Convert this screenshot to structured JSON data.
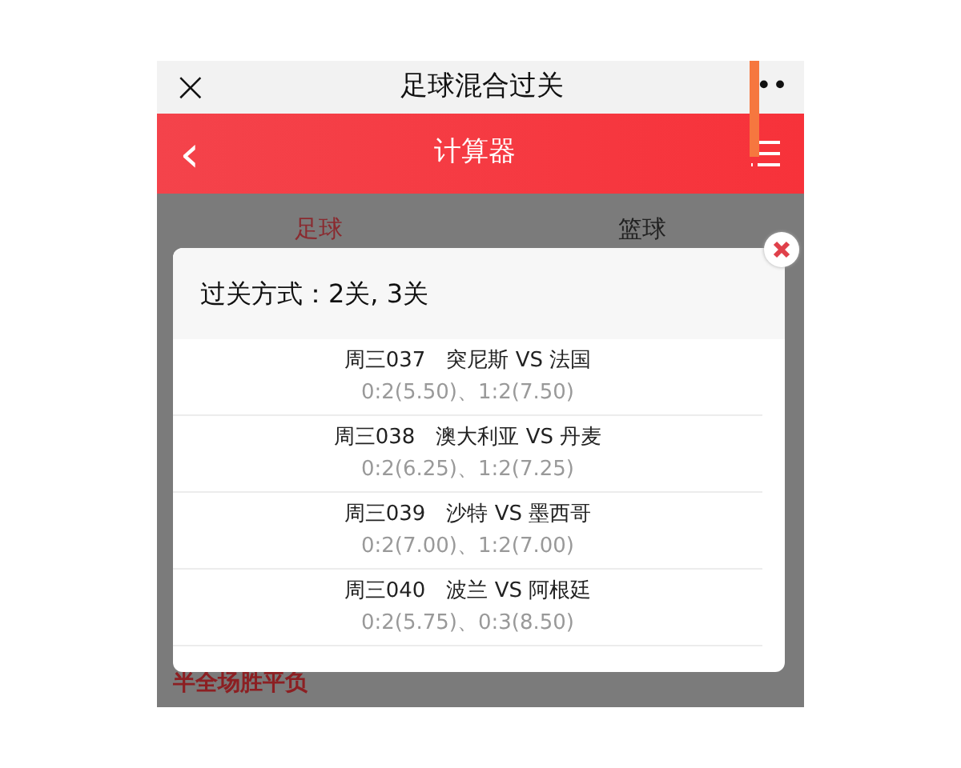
{
  "top_bar": {
    "close": "×",
    "title": "足球混合过关",
    "more": "••"
  },
  "header": {
    "back": "‹",
    "title": "计算器"
  },
  "tabs": [
    {
      "label": "足球",
      "selected": true
    },
    {
      "label": "篮球",
      "selected": false
    }
  ],
  "section_label": "半全场胜平负",
  "dialog": {
    "title": "过关方式：2关, 3关",
    "matches": [
      {
        "match": "周三037　突尼斯 VS 法国",
        "picks": "0:2(5.50)、1:2(7.50)"
      },
      {
        "match": "周三038　澳大利亚 VS 丹麦",
        "picks": "0:2(6.25)、1:2(7.25)"
      },
      {
        "match": "周三039　沙特 VS 墨西哥",
        "picks": "0:2(7.00)、1:2(7.00)"
      },
      {
        "match": "周三040　波兰 VS 阿根廷",
        "picks": "0:2(5.75)、0:3(8.50)"
      }
    ]
  }
}
